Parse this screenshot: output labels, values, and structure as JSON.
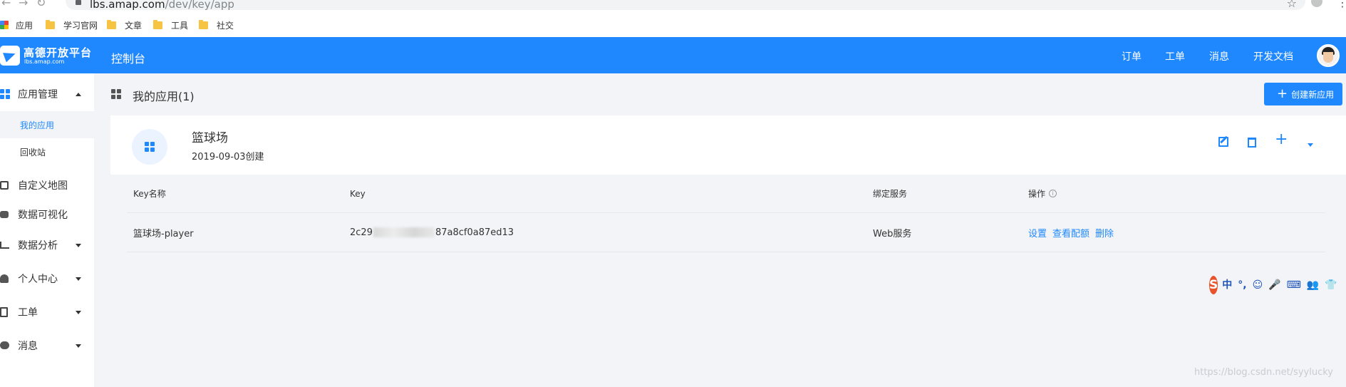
{
  "browser": {
    "url_host": "lbs.amap.com",
    "url_path": "/dev/key/app",
    "bookmarks": [
      {
        "label": "应用",
        "icon": "apps-grid-icon"
      },
      {
        "label": "学习官网",
        "icon": "folder-icon"
      },
      {
        "label": "文章",
        "icon": "folder-icon"
      },
      {
        "label": "工具",
        "icon": "folder-icon"
      },
      {
        "label": "社交",
        "icon": "folder-icon"
      }
    ]
  },
  "header": {
    "logo_name": "高德开放平台",
    "logo_sub": "lbs.amap.com",
    "console": "控制台",
    "nav": [
      "订单",
      "工单",
      "消息",
      "开发文档"
    ]
  },
  "sidebar": {
    "items": [
      {
        "label": "应用管理",
        "expanded": true
      },
      {
        "label": "我的应用",
        "sub": true,
        "active": true
      },
      {
        "label": "回收站",
        "sub": true
      },
      {
        "label": "自定义地图"
      },
      {
        "label": "数据可视化"
      },
      {
        "label": "数据分析",
        "expandable": true
      },
      {
        "label": "个人中心",
        "expandable": true
      },
      {
        "label": "工单",
        "expandable": true
      },
      {
        "label": "消息",
        "expandable": true
      }
    ]
  },
  "main": {
    "title": "我的应用(1)",
    "create_button": "创建新应用",
    "app": {
      "name": "篮球场",
      "created": "2019-09-03创建"
    },
    "table": {
      "headers": [
        "Key名称",
        "Key",
        "绑定服务",
        "操作"
      ],
      "rows": [
        {
          "key_name": "篮球场-player",
          "key_prefix": "2c29",
          "key_suffix": "87a8cf0a87ed13",
          "service": "Web服务",
          "actions": [
            "设置",
            "查看配额",
            "删除"
          ]
        }
      ]
    }
  },
  "ime": {
    "logo": "S",
    "glyphs": [
      "中",
      "°,",
      "☺",
      "🎤",
      "⌨",
      "👥",
      "👕",
      "⋮"
    ]
  },
  "watermark": "https://blog.csdn.net/syylucky",
  "colors": {
    "accent": "#1f88ff",
    "background": "#f2f4f7"
  }
}
